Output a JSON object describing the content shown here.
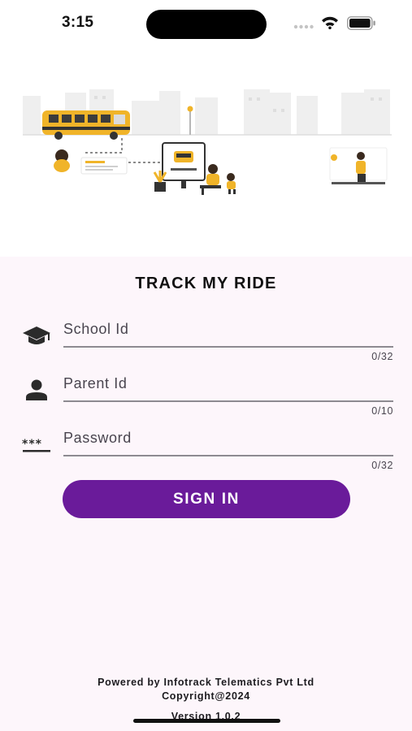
{
  "status_bar": {
    "time": "3:15"
  },
  "app": {
    "title": "TRACK MY RIDE"
  },
  "form": {
    "school_id": {
      "placeholder": "School Id",
      "value": "",
      "counter": "0/32"
    },
    "parent_id": {
      "placeholder": "Parent Id",
      "value": "",
      "counter": "0/10"
    },
    "password": {
      "placeholder": "Password",
      "value": "",
      "counter": "0/32"
    },
    "submit_label": "SIGN IN"
  },
  "footer": {
    "powered_by": "Powered by Infotrack Telematics Pvt Ltd",
    "copyright": "Copyright@2024",
    "version": "Version 1.0.2"
  },
  "colors": {
    "accent": "#6a1b9a",
    "panel_background": "#fdf6fb",
    "illustration_yellow": "#f0b429"
  },
  "icons": {
    "school_id": "graduation-cap-icon",
    "parent_id": "person-icon",
    "password": "password-dots-icon"
  }
}
